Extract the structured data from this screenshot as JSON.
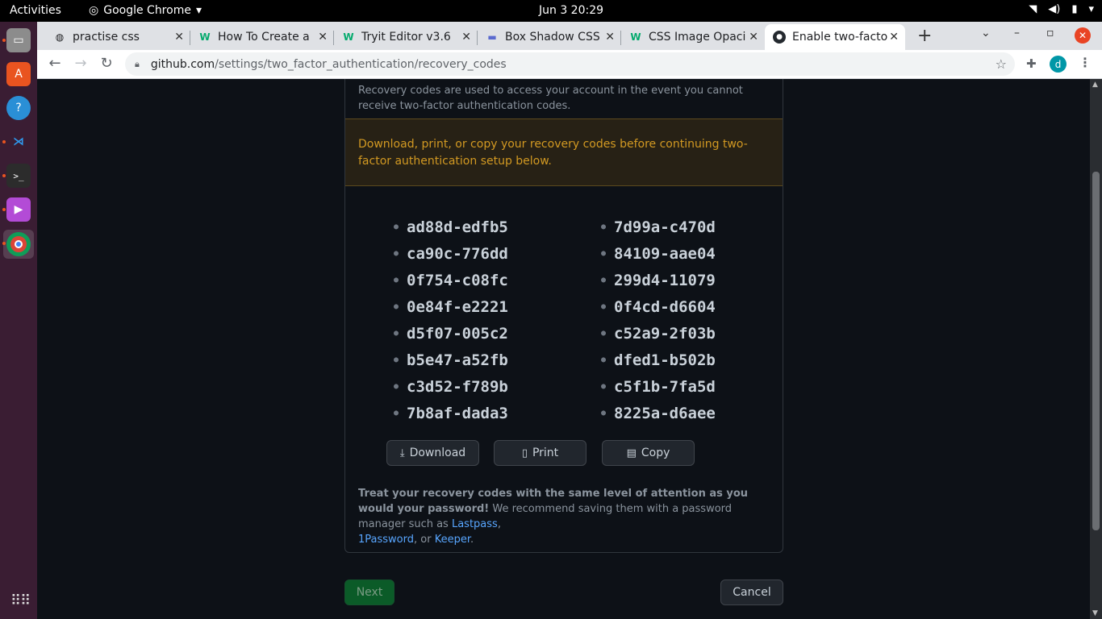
{
  "topbar": {
    "activities": "Activities",
    "app_name": "Google Chrome",
    "clock": "Jun 3  20:29"
  },
  "dock": {
    "items": [
      "files-icon",
      "software-icon",
      "help-icon",
      "vscode-icon",
      "terminal-icon",
      "video-icon",
      "chrome-icon"
    ]
  },
  "tabs": [
    {
      "title": "practise css",
      "icon": "globe-icon",
      "active": false
    },
    {
      "title": "How To Create a",
      "icon": "w3schools-icon",
      "active": false
    },
    {
      "title": "Tryit Editor v3.6",
      "icon": "w3schools-icon",
      "active": false
    },
    {
      "title": "Box Shadow CSS",
      "icon": "page-icon",
      "active": false
    },
    {
      "title": "CSS Image Opaci",
      "icon": "w3schools-icon",
      "active": false
    },
    {
      "title": "Enable two-facto",
      "icon": "github-icon",
      "active": true
    }
  ],
  "omnibox": {
    "host": "github.com",
    "path": "/settings/two_factor_authentication/recovery_codes"
  },
  "profile_initial": "d",
  "page": {
    "intro": "Recovery codes are used to access your account in the event you cannot receive two-factor authentication codes.",
    "warning": "Download, print, or copy your recovery codes before continuing two-factor authentication setup below.",
    "codes_left": [
      "ad88d-edfb5",
      "ca90c-776dd",
      "0f754-c08fc",
      "0e84f-e2221",
      "d5f07-005c2",
      "b5e47-a52fb",
      "c3d52-f789b",
      "7b8af-dada3"
    ],
    "codes_right": [
      "7d99a-c470d",
      "84109-aae04",
      "299d4-11079",
      "0f4cd-d6604",
      "c52a9-2f03b",
      "dfed1-b502b",
      "c5f1b-7fa5d",
      "8225a-d6aee"
    ],
    "buttons": {
      "download": "Download",
      "print": "Print",
      "copy": "Copy"
    },
    "footnote": {
      "bold": "Treat your recovery codes with the same level of attention as you would your password!",
      "text": " We recommend saving them with a password manager such as ",
      "link1": "Lastpass",
      "sep1": ", ",
      "link2": "1Password",
      "sep2": ", or ",
      "link3": "Keeper",
      "end": "."
    },
    "next": "Next",
    "cancel": "Cancel"
  },
  "colors": {
    "page_bg": "#0d1117",
    "warning_text": "#d29922",
    "link": "#58a6ff",
    "next_button": "#0b5b28"
  }
}
